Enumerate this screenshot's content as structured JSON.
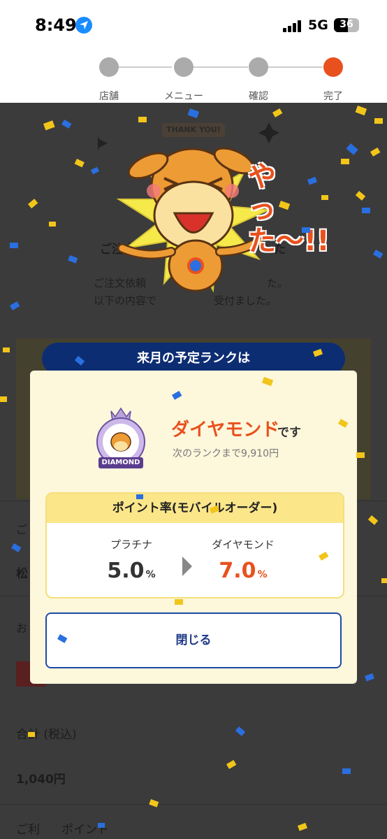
{
  "status_bar": {
    "time": "8:49",
    "network": "5G",
    "battery": "36",
    "icons": [
      "location-arrow-icon",
      "signal-icon",
      "battery-icon"
    ]
  },
  "stepper": {
    "steps": [
      {
        "label": "店舗",
        "state": "done"
      },
      {
        "label": "メニュー",
        "state": "done"
      },
      {
        "label": "確認",
        "state": "done"
      },
      {
        "label": "完了",
        "state": "current"
      }
    ]
  },
  "background_page": {
    "badge_text": "THANK YOU!",
    "mascot_exclaim": "やった〜!!",
    "title": "ご注文",
    "title_tail": "た",
    "message_line1": "ご注文依頼",
    "message_line1_tail": "た。",
    "message_line2": "以下の内容で",
    "message_line2_tail": "受付ました。",
    "frag_go": "ご",
    "frag_matsu": "松",
    "frag_o": "お",
    "total_label": "合計 (税込)",
    "total_value": "1,040円",
    "points_label_a": "ご利",
    "points_label_b": "ポイント"
  },
  "modal": {
    "header": "来月の予定ランクは",
    "badge_label": "DIAMOND",
    "rank_name": "ダイヤモンド",
    "rank_suffix": "です",
    "next_rank_text": "次のランクまで9,910円",
    "point_rate_title": "ポイント率(モバイルオーダー)",
    "current": {
      "label": "プラチナ",
      "value": "5.0",
      "unit": "%"
    },
    "next": {
      "label": "ダイヤモンド",
      "value": "7.0",
      "unit": "%"
    },
    "close_label": "閉じる"
  },
  "colors": {
    "accent_orange": "#e8511e",
    "navy": "#0d2d73",
    "button_border": "#1f4aa8",
    "modal_bg": "#fdf7dc",
    "rate_header_bg": "#fbe68a"
  }
}
